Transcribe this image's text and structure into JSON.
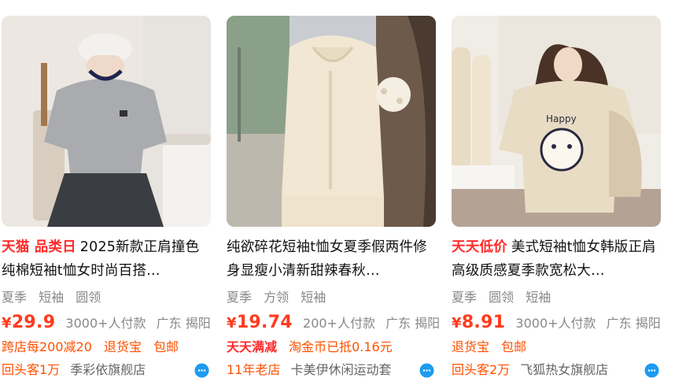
{
  "products": [
    {
      "tag": "天猫 品类日",
      "title": "2025新款正肩撞色纯棉短袖t恤女时尚百搭…",
      "attrs": [
        "夏季",
        "短袖",
        "圆领"
      ],
      "price_symbol": "¥",
      "price": "29.9",
      "sold": "3000+人付款",
      "location": "广东 揭阳",
      "promos": [
        "跨店每200减20",
        "退货宝",
        "包邮"
      ],
      "shop_badge": "回头客1万",
      "shop_name": "季彩依旗舰店",
      "chat_icon": "chat-bubble-icon"
    },
    {
      "tag": "",
      "title": "纯欲碎花短袖t恤女夏季假两件修身显瘦小清新甜辣春秋…",
      "attrs": [
        "夏季",
        "方领",
        "短袖"
      ],
      "price_symbol": "¥",
      "price": "19.74",
      "sold": "200+人付款",
      "location": "广东 揭阳",
      "promos": [
        "天天满减",
        "淘金币已抵0.16元"
      ],
      "shop_badge": "11年老店",
      "shop_name": "卡美伊休闲运动套",
      "chat_icon": "chat-bubble-icon"
    },
    {
      "tag": "天天低价",
      "title": "美式短袖t恤女韩版正肩高级质感夏季款宽松大…",
      "attrs": [
        "夏季",
        "圆领",
        "短袖"
      ],
      "price_symbol": "¥",
      "price": "8.91",
      "sold": "3000+人付款",
      "location": "广东 揭阳",
      "promos": [
        "退货宝",
        "包邮"
      ],
      "shop_badge": "回头客2万",
      "shop_name": "飞狐热女旗舰店",
      "chat_icon": "chat-bubble-icon"
    }
  ],
  "colors": {
    "tag_red": "#ff2a2a",
    "price_orange": "#ff3a1f",
    "promo_orange": "#ff5000",
    "chat_blue": "#1d9bf0"
  }
}
